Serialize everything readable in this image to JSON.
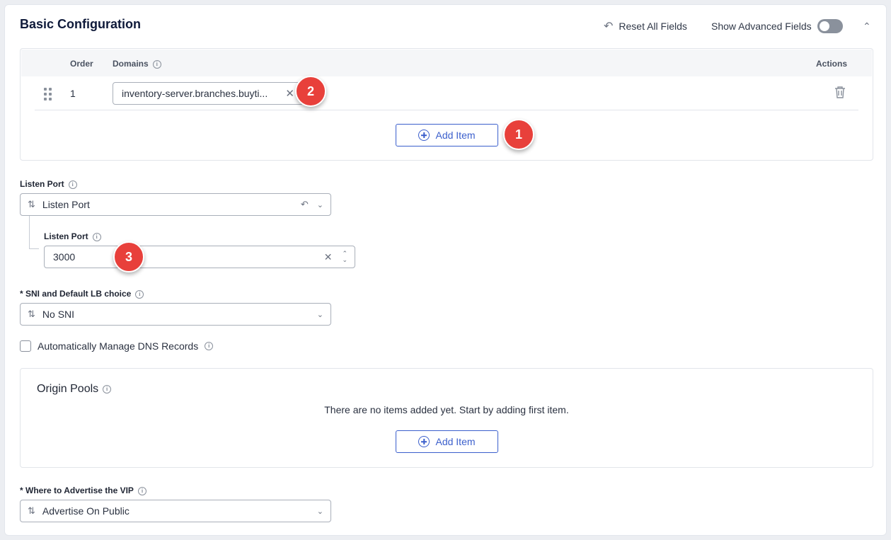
{
  "section": {
    "title": "Basic Configuration",
    "reset_label": "Reset All Fields",
    "advanced_label": "Show Advanced Fields",
    "advanced_enabled": false
  },
  "domains_table": {
    "headers": {
      "order": "Order",
      "domains": "Domains",
      "actions": "Actions"
    },
    "rows": [
      {
        "order": "1",
        "domain": "inventory-server.branches.buyti..."
      }
    ],
    "add_label": "Add Item"
  },
  "listen_port": {
    "label": "Listen Port",
    "choice": "Listen Port",
    "sub_label": "Listen Port",
    "value": "3000"
  },
  "sni": {
    "label": "* SNI and Default LB choice",
    "choice": "No SNI"
  },
  "dns": {
    "label": "Automatically Manage DNS Records",
    "checked": false
  },
  "origin_pools": {
    "title": "Origin Pools",
    "empty_text": "There are no items added yet. Start by adding first item.",
    "add_label": "Add Item"
  },
  "advertise": {
    "label": "* Where to Advertise the VIP",
    "choice": "Advertise On Public"
  },
  "annotations": {
    "badge1": "1",
    "badge2": "2",
    "badge3": "3"
  },
  "colors": {
    "accent": "#3b5fcc",
    "badge": "#e8403b"
  }
}
